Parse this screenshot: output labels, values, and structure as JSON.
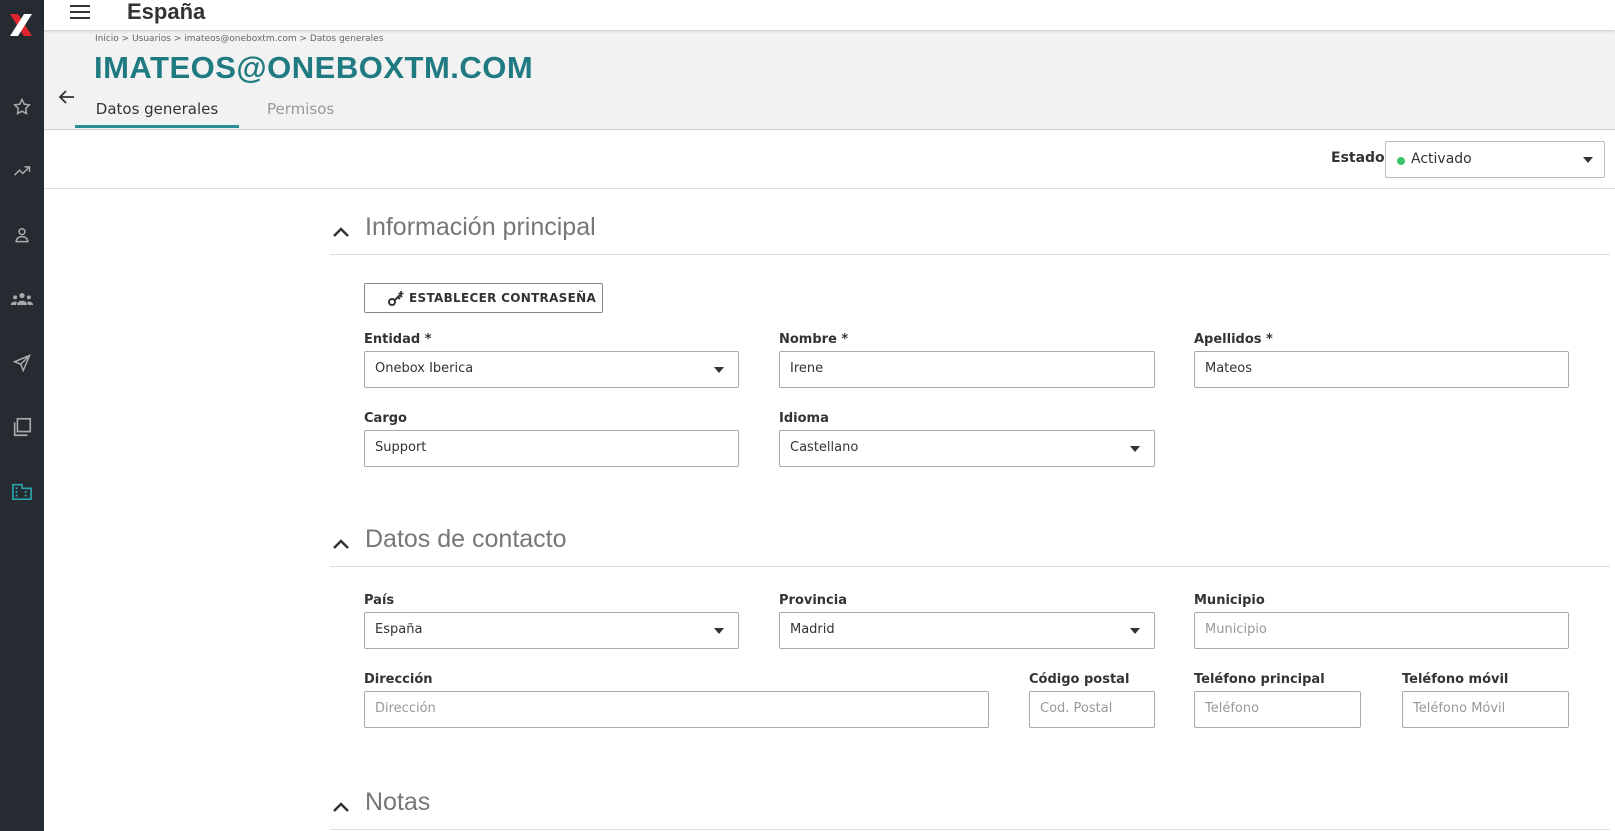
{
  "app": {
    "title": "España"
  },
  "breadcrumb": "Inicio > Usuarios > imateos@oneboxtm.com > Datos generales",
  "page_title": "IMATEOS@ONEBOXTM.COM",
  "tabs": [
    {
      "label": "Datos generales"
    },
    {
      "label": "Permisos"
    }
  ],
  "estado": {
    "label": "Estado",
    "value": "Activado"
  },
  "sections": {
    "main": {
      "title": "Información principal",
      "set_password": "ESTABLECER CONTRASEÑA"
    },
    "contact": {
      "title": "Datos de contacto"
    },
    "notes": {
      "title": "Notas"
    }
  },
  "fields": {
    "entidad": {
      "label": "Entidad *",
      "value": "Onebox Iberica"
    },
    "nombre": {
      "label": "Nombre *",
      "value": "Irene"
    },
    "apellidos": {
      "label": "Apellidos *",
      "value": "Mateos"
    },
    "cargo": {
      "label": "Cargo",
      "value": "Support"
    },
    "idioma": {
      "label": "Idioma",
      "value": "Castellano"
    },
    "pais": {
      "label": "País",
      "value": "España"
    },
    "provincia": {
      "label": "Provincia",
      "value": "Madrid"
    },
    "municipio": {
      "label": "Municipio",
      "placeholder": "Municipio"
    },
    "direccion": {
      "label": "Dirección",
      "placeholder": "Dirección"
    },
    "codigo_postal": {
      "label": "Código postal",
      "placeholder": "Cod. Postal"
    },
    "telefono": {
      "label": "Teléfono principal",
      "placeholder": "Teléfono"
    },
    "movil": {
      "label": "Teléfono móvil",
      "placeholder": "Teléfono Móvil"
    }
  },
  "colors": {
    "accent": "#1f7a82",
    "sidebar": "#262b31",
    "active": "#3cc46a",
    "logo": "#e0252e"
  },
  "icons": [
    "logo-icon",
    "star-icon",
    "trending-icon",
    "person-icon",
    "group-icon",
    "send-icon",
    "copy-icon",
    "building-icon",
    "menu-icon",
    "back-arrow-icon",
    "chevron-up-icon",
    "key-icon"
  ]
}
